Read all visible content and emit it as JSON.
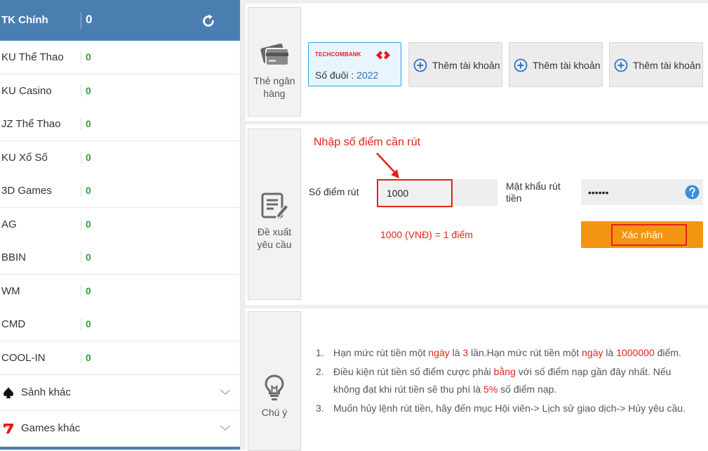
{
  "sidebar": {
    "main_account": {
      "name": "TK Chính",
      "balance": "0"
    },
    "accounts": [
      {
        "name": "KU Thể Thao",
        "balance": "0"
      },
      {
        "name": "KU Casino",
        "balance": "0"
      },
      {
        "name": "JZ Thể Thao",
        "balance": "0"
      },
      {
        "name": "KU Xổ Số",
        "balance": "0"
      },
      {
        "name": "3D Games",
        "balance": "0"
      },
      {
        "name": "AG",
        "balance": "0"
      },
      {
        "name": "BBIN",
        "balance": "0"
      },
      {
        "name": "WM",
        "balance": "0"
      },
      {
        "name": "CMD",
        "balance": "0"
      },
      {
        "name": "COOL-IN",
        "balance": "0"
      }
    ],
    "groups": [
      {
        "label": "Sảnh khác",
        "icon": "spade-icon"
      },
      {
        "label": "Games khác",
        "icon": "lucky-seven-icon"
      }
    ]
  },
  "bank_section": {
    "side_label_1": "Thẻ ngân",
    "side_label_2": "hàng",
    "bank_card": {
      "bank_name": "TECHCOMBANK",
      "suffix_label": "Số đuôi :",
      "suffix_value": "2022"
    },
    "add_buttons": [
      "Thêm tài khoản",
      "Thêm tài khoản",
      "Thêm tài khoản"
    ]
  },
  "withdraw_section": {
    "side_label_1": "Đề xuất",
    "side_label_2": "yêu cầu",
    "hint": "Nhập số điểm cần rút",
    "amount_label": "Số điểm rút",
    "amount_value": "1000",
    "password_label_1": "Mật khẩu rút",
    "password_label_2": "tiền",
    "password_value": "••••••",
    "rate_text": "1000 (VNĐ) = 1 điểm",
    "confirm_label": "Xác nhận"
  },
  "notes_section": {
    "side_label": "Chú ý",
    "notes": [
      {
        "num": "1.",
        "p1": "Hạn mức rút tiền một ",
        "r1": "ngày",
        "p2": " là ",
        "r2": "3",
        "p3": " lần.Hạn mức rút tiền một ",
        "r3": "ngày",
        "p4": " là ",
        "r4": "1000000",
        "p5": " điểm."
      },
      {
        "num": "2.",
        "p1": "Điều kiện rút tiền số điểm cược phải ",
        "r1": "bằng",
        "p2": " với số điểm nạp gần đây nhất. Nếu không đạt khi rút tiền sẽ thu phí là ",
        "r2": "5%",
        "p3": " số điểm nạp."
      },
      {
        "num": "3.",
        "p1": "Muốn hủy lệnh rút tiền, hãy đến mục Hội viên-> Lịch sử giao dịch-> Hủy yêu cầu."
      }
    ]
  },
  "colors": {
    "sidebar_header": "#4a7eb0",
    "balance_green": "#2aa336",
    "accent_red": "#e3231a",
    "confirm_orange": "#f39512",
    "bank_blue": "#29a8e4"
  }
}
